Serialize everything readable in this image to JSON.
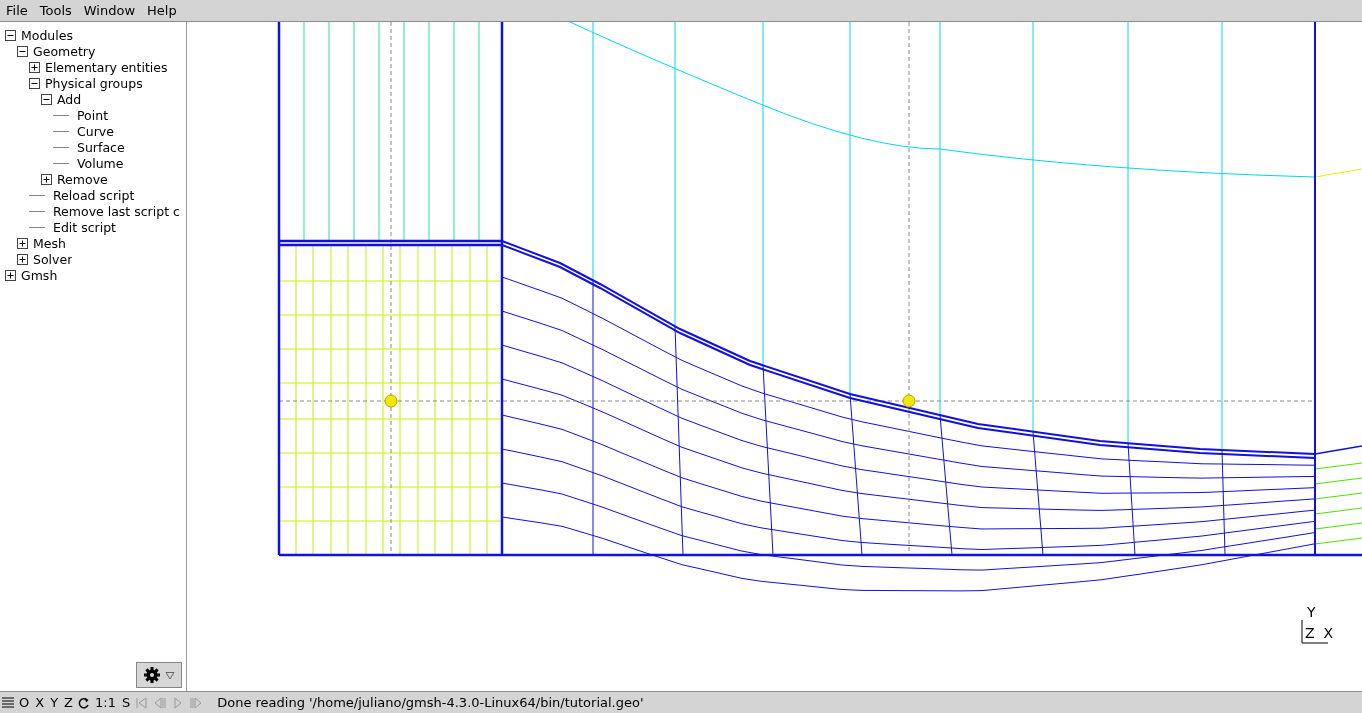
{
  "menu": [
    {
      "label": "File"
    },
    {
      "label": "Tools"
    },
    {
      "label": "Window"
    },
    {
      "label": "Help"
    }
  ],
  "tree": [
    {
      "label": "Modules",
      "expanded": true,
      "children": [
        {
          "label": "Geometry",
          "expanded": true,
          "children": [
            {
              "label": "Elementary entities",
              "expanded": false
            },
            {
              "label": "Physical groups",
              "expanded": true,
              "children": [
                {
                  "label": "Add",
                  "expanded": true,
                  "children": [
                    {
                      "label": "Point"
                    },
                    {
                      "label": "Curve"
                    },
                    {
                      "label": "Surface"
                    },
                    {
                      "label": "Volume"
                    }
                  ]
                },
                {
                  "label": "Remove",
                  "expanded": false
                }
              ]
            },
            {
              "label": "Reload script"
            },
            {
              "label": "Remove last script c"
            },
            {
              "label": "Edit script"
            }
          ]
        },
        {
          "label": "Mesh",
          "expanded": false
        },
        {
          "label": "Solver",
          "expanded": false
        }
      ]
    },
    {
      "label": "Gmsh",
      "expanded": false
    }
  ],
  "axes": {
    "y": "Y",
    "z": "Z",
    "x": "X"
  },
  "status_bar": {
    "view_buttons": [
      "O",
      "X",
      "Y",
      "Z"
    ],
    "scale_buttons": [
      "1:1",
      "S"
    ],
    "playback": [
      {
        "kind": "first",
        "disabled": true
      },
      {
        "kind": "prev",
        "disabled": true
      },
      {
        "kind": "next",
        "disabled": true
      },
      {
        "kind": "last",
        "disabled": true
      }
    ],
    "message": "Done reading '/home/juliano/gmsh-4.3.0-Linux64/bin/tutorial.geo'"
  }
}
